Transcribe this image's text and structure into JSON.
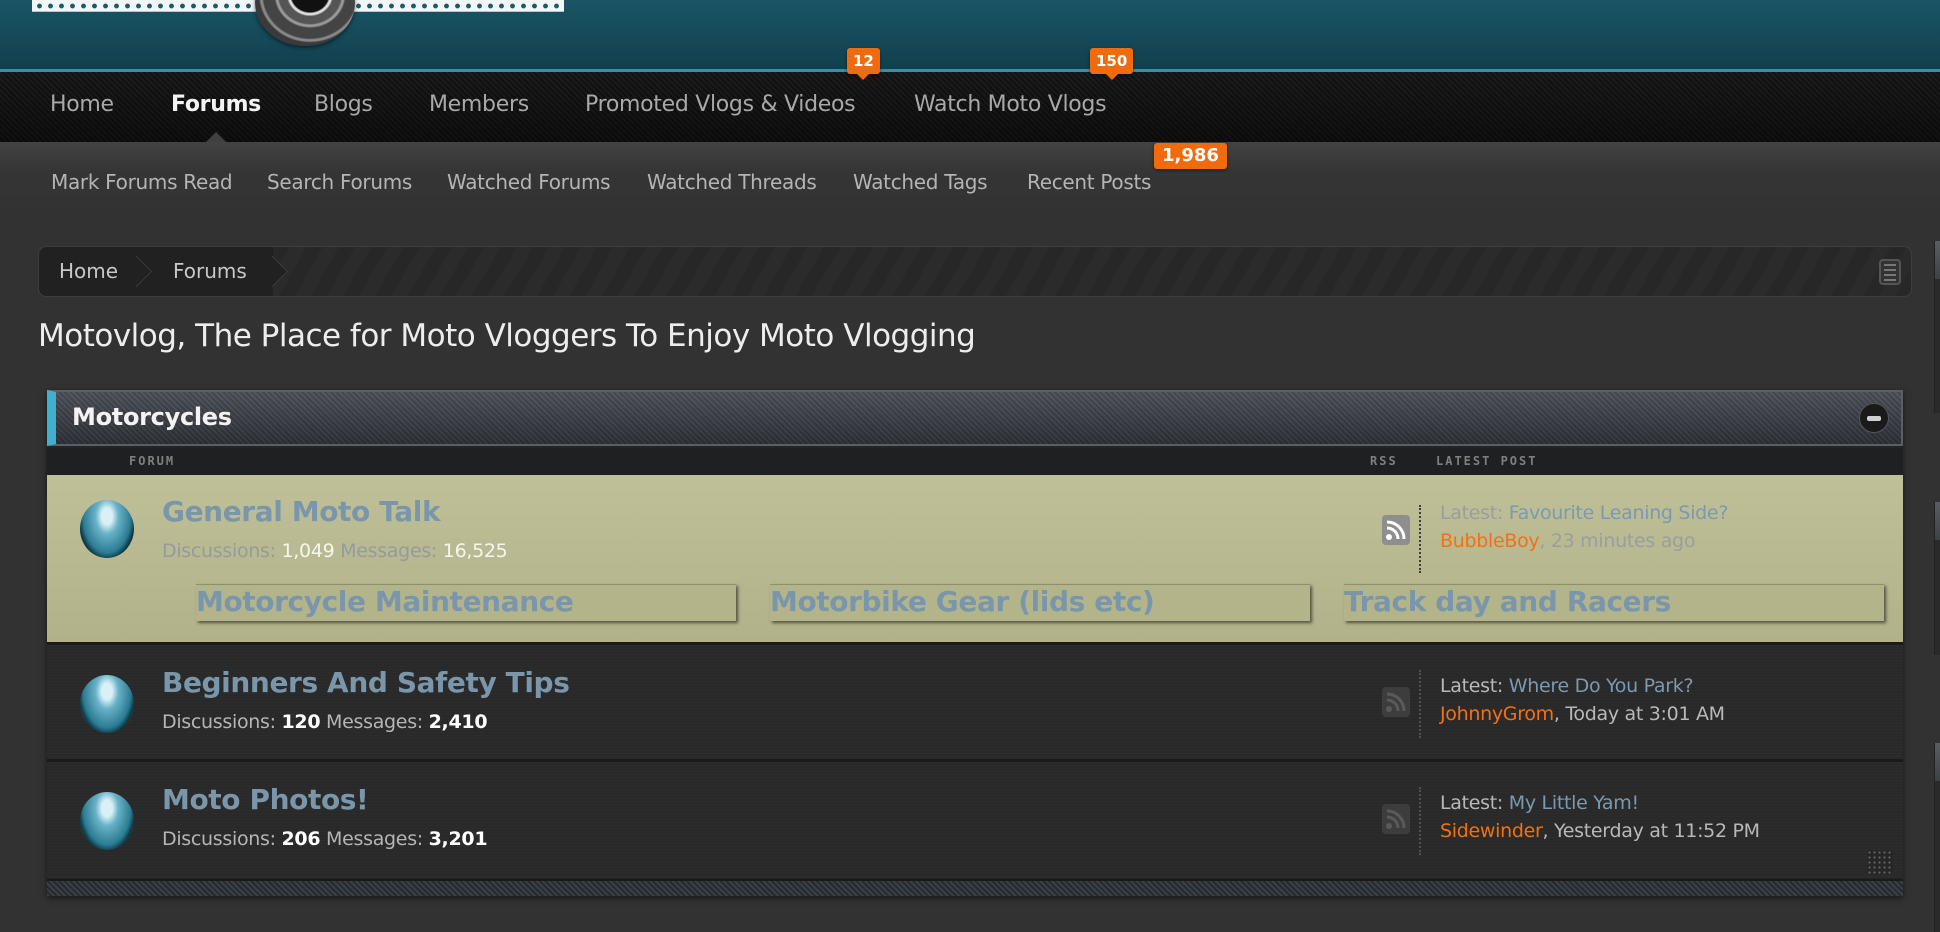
{
  "header": {
    "logo_alt": "Motovlog logo"
  },
  "nav": {
    "items": [
      {
        "label": "Home",
        "active": false
      },
      {
        "label": "Forums",
        "active": true
      },
      {
        "label": "Blogs",
        "active": false
      },
      {
        "label": "Members",
        "active": false
      },
      {
        "label": "Promoted Vlogs & Videos",
        "active": false,
        "badge": "12"
      },
      {
        "label": "Watch Moto Vlogs",
        "active": false,
        "badge": "150"
      }
    ]
  },
  "subnav": {
    "items": [
      {
        "label": "Mark Forums Read"
      },
      {
        "label": "Search Forums"
      },
      {
        "label": "Watched Forums"
      },
      {
        "label": "Watched Threads"
      },
      {
        "label": "Watched Tags"
      },
      {
        "label": "Recent Posts",
        "badge": "1,986"
      }
    ]
  },
  "breadcrumb": {
    "items": [
      "Home",
      "Forums"
    ],
    "menu_icon": "list-icon"
  },
  "page_title": "Motovlog, The Place for Moto Vloggers To Enjoy Moto Vlogging",
  "category": {
    "title": "Motorcycles",
    "collapse_icon": "minus-circle-icon",
    "columns": {
      "forum": "FORUM",
      "rss": "RSS",
      "latest": "LATEST POST"
    },
    "forums": [
      {
        "title": "General Moto Talk",
        "discussions_label": "Discussions:",
        "discussions": "1,049",
        "messages_label": "Messages:",
        "messages": "16,525",
        "latest_label": "Latest:",
        "latest_title": "Favourite Leaning Side?",
        "latest_user": "BubbleBoy",
        "latest_time": ", 23 minutes ago",
        "highlighted": true,
        "subforums": [
          "Motorcycle Maintenance",
          "Motorbike Gear (lids etc)",
          "Track day and Racers"
        ]
      },
      {
        "title": "Beginners And Safety Tips",
        "discussions_label": "Discussions:",
        "discussions": "120",
        "messages_label": "Messages:",
        "messages": "2,410",
        "latest_label": "Latest:",
        "latest_title": "Where Do You Park?",
        "latest_user": "JohnnyGrom",
        "latest_time": ", Today at 3:01 AM",
        "highlighted": false
      },
      {
        "title": "Moto Photos!",
        "discussions_label": "Discussions:",
        "discussions": "206",
        "messages_label": "Messages:",
        "messages": "3,201",
        "latest_label": "Latest:",
        "latest_title": "My Little Yam!",
        "latest_user": "Sidewinder",
        "latest_time": ", Yesterday at 11:52 PM",
        "highlighted": false
      }
    ]
  },
  "colors": {
    "accent_teal": "#3fb0cf",
    "badge_orange": "#f06b0d",
    "user_orange": "#f27113",
    "link_blue": "#7b99b0",
    "highlight_row": "#bfc097"
  }
}
